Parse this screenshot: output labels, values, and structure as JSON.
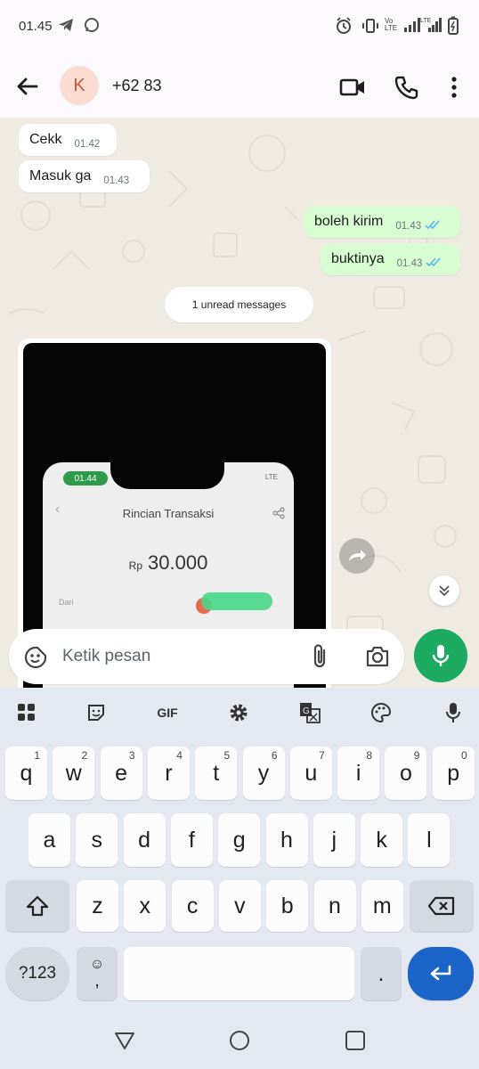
{
  "status_bar": {
    "time": "01.45",
    "volte_label": "Vo LTE",
    "lte_label": "LTE"
  },
  "header": {
    "avatar_letter": "K",
    "contact_name": "+62 83"
  },
  "messages": [
    {
      "text": "Cekk",
      "time": "01.42",
      "direction": "in"
    },
    {
      "text": "Masuk ga",
      "time": "01.43",
      "direction": "in"
    },
    {
      "text": "boleh kirim",
      "time": "01.43",
      "direction": "out",
      "read": true
    },
    {
      "text": "buktinya",
      "time": "01.43",
      "direction": "out",
      "read": true
    }
  ],
  "unread_banner": "1 unread messages",
  "image_message": {
    "phone_time": "01.44",
    "phone_signal": "LTE",
    "screen_title": "Rincian Transaksi",
    "currency": "Rp",
    "amount": "30.000",
    "from_label": "Dari"
  },
  "composer": {
    "placeholder": "Ketik pesan"
  },
  "keyboard": {
    "toolbar": [
      "apps-icon",
      "sticker-icon",
      "GIF",
      "settings-icon",
      "translate-icon",
      "palette-icon",
      "mic-icon"
    ],
    "gif_label": "GIF",
    "row1": [
      {
        "k": "q",
        "h": "1"
      },
      {
        "k": "w",
        "h": "2"
      },
      {
        "k": "e",
        "h": "3"
      },
      {
        "k": "r",
        "h": "4"
      },
      {
        "k": "t",
        "h": "5"
      },
      {
        "k": "y",
        "h": "6"
      },
      {
        "k": "u",
        "h": "7"
      },
      {
        "k": "i",
        "h": "8"
      },
      {
        "k": "o",
        "h": "9"
      },
      {
        "k": "p",
        "h": "0"
      }
    ],
    "row2": [
      "a",
      "s",
      "d",
      "f",
      "g",
      "h",
      "j",
      "k",
      "l"
    ],
    "row3": [
      "z",
      "x",
      "c",
      "v",
      "b",
      "n",
      "m"
    ],
    "symbols_label": "?123",
    "comma": ",",
    "period": "."
  },
  "colors": {
    "accent_green": "#1daa61",
    "outgoing_bubble": "#d9fdd3",
    "read_ticks": "#53bdeb",
    "enter_key": "#1b64c8"
  }
}
